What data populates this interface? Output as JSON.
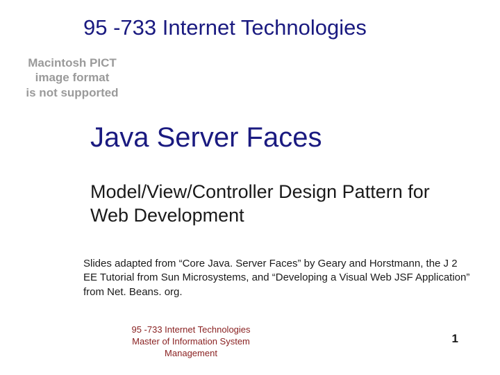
{
  "header": {
    "course_title": "95 -733 Internet Technologies"
  },
  "warning": {
    "line1": "Macintosh PICT",
    "line2": "image format",
    "line3": "is not supported"
  },
  "main": {
    "title": "Java Server Faces",
    "subtitle": "Model/View/Controller Design Pattern for Web Development"
  },
  "credits": {
    "text": "Slides adapted from “Core Java. Server Faces” by Geary and Horstmann, the J 2 EE Tutorial from Sun Microsystems, and “Developing a Visual Web JSF Application” from Net. Beans. org."
  },
  "footer": {
    "course": "95 -733 Internet Technologies",
    "program": "Master of Information System Management",
    "page": "1"
  }
}
